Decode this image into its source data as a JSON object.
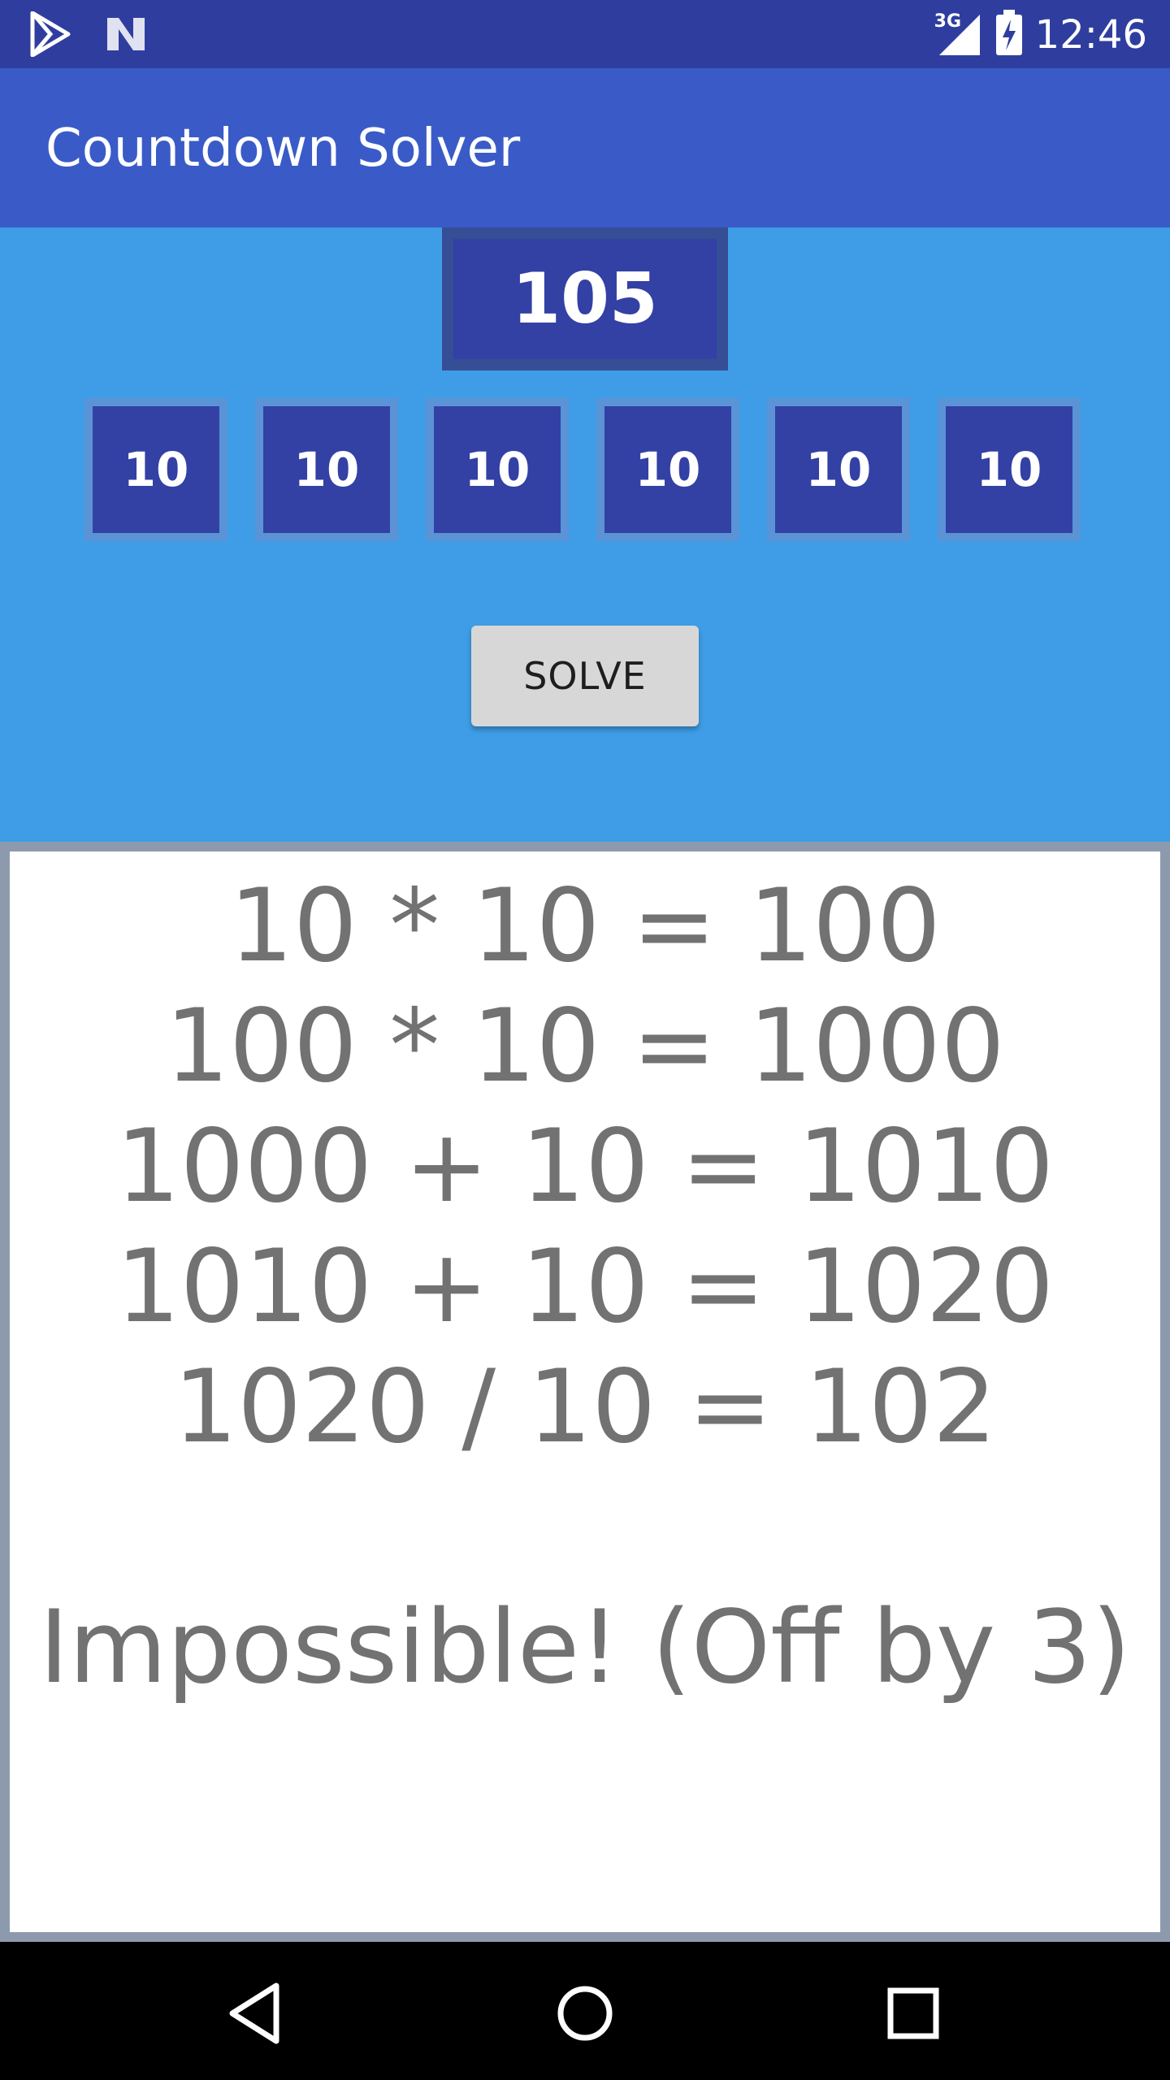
{
  "status_bar": {
    "network_label": "3G",
    "time": "12:46",
    "icons": [
      "play-store-icon",
      "n-logo-icon",
      "signal-icon",
      "battery-charging-icon"
    ],
    "background": "#2f3e9e"
  },
  "app_bar": {
    "title": "Countdown Solver",
    "background": "#3a5bc7"
  },
  "inputs": {
    "target": "105",
    "numbers": [
      "10",
      "10",
      "10",
      "10",
      "10",
      "10"
    ],
    "solve_label": "SOLVE",
    "panel_color": "#3e9de6",
    "tile_color": "#3340a4"
  },
  "result": {
    "steps": [
      "10 * 10 = 100",
      "100 * 10 = 1000",
      "1000 + 10 = 1010",
      "1010 + 10 = 1020",
      "1020 / 10 = 102"
    ],
    "verdict": "Impossible! (Off by 3)",
    "text_color": "#727272"
  },
  "nav_bar": {
    "icons": [
      "back-icon",
      "home-icon",
      "recents-icon"
    ]
  }
}
